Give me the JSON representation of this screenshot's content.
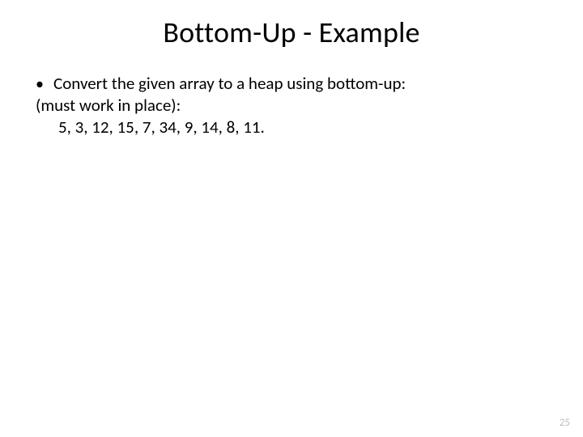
{
  "title": "Bottom-Up - Example",
  "bullet1": "Convert the given array to a heap using bottom-up:",
  "line2": "(must work in place):",
  "line3": "5, 3, 12, 15, 7, 34, 9, 14, 8, 11.",
  "page": "25"
}
